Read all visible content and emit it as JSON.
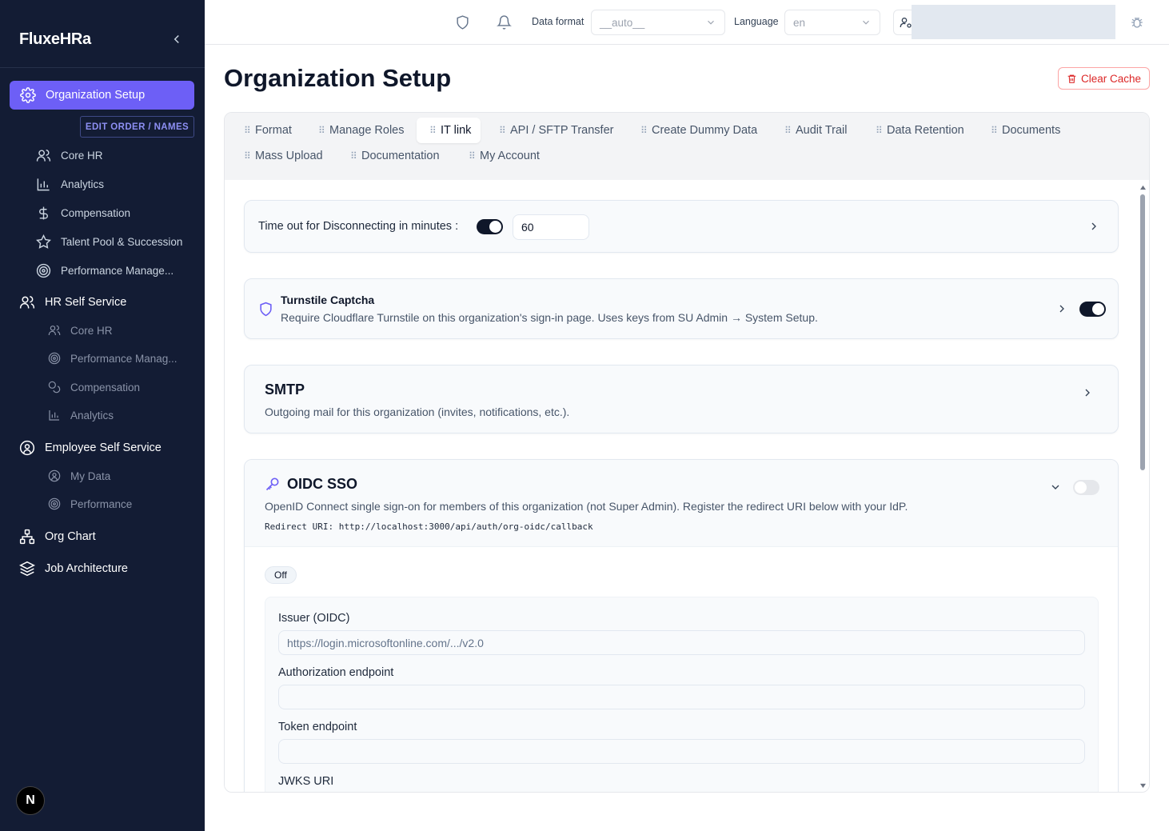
{
  "sidebar": {
    "brand": "FluxeHRa",
    "active_item": "Organization Setup",
    "edit_order_label": "EDIT ORDER / NAMES",
    "group1": [
      {
        "label": "Core HR"
      },
      {
        "label": "Analytics"
      },
      {
        "label": "Compensation"
      },
      {
        "label": "Talent Pool & Succession"
      },
      {
        "label": "Performance Manage..."
      }
    ],
    "hr_self_service": "HR Self Service",
    "group2": [
      {
        "label": "Core HR"
      },
      {
        "label": "Performance Manag..."
      },
      {
        "label": "Compensation"
      },
      {
        "label": "Analytics"
      }
    ],
    "employee_self_service": "Employee Self Service",
    "group3": [
      {
        "label": "My Data"
      },
      {
        "label": "Performance"
      }
    ],
    "org_chart": "Org Chart",
    "job_architecture": "Job Architecture",
    "bottom_logo": "N"
  },
  "topbar": {
    "data_format_label": "Data format",
    "data_format_value": "__auto__",
    "language_label": "Language",
    "language_value": "en"
  },
  "page": {
    "title": "Organization Setup",
    "clear_cache": "Clear Cache"
  },
  "tabs": [
    {
      "label": "Format"
    },
    {
      "label": "Manage Roles"
    },
    {
      "label": "IT link"
    },
    {
      "label": "API / SFTP Transfer"
    },
    {
      "label": "Create Dummy Data"
    },
    {
      "label": "Audit Trail"
    },
    {
      "label": "Data Retention"
    },
    {
      "label": "Documents"
    },
    {
      "label": "Mass Upload"
    },
    {
      "label": "Documentation"
    },
    {
      "label": "My Account"
    }
  ],
  "timeout": {
    "label": "Time out for Disconnecting in minutes :",
    "value": "60",
    "enabled": true
  },
  "turnstile": {
    "title": "Turnstile Captcha",
    "description": "Require Cloudflare Turnstile on this organization's sign-in page. Uses keys from SU Admin → System Setup.",
    "enabled": true
  },
  "smtp": {
    "title": "SMTP",
    "description": "Outgoing mail for this organization (invites, notifications, etc.)."
  },
  "oidc": {
    "title": "OIDC SSO",
    "description": "OpenID Connect single sign-on for members of this organization (not Super Admin). Register the redirect URI below with your IdP.",
    "redirect_uri": "Redirect URI: http://localhost:3000/api/auth/org-oidc/callback",
    "status_badge": "Off",
    "enabled": false,
    "fields": {
      "issuer_label": "Issuer (OIDC)",
      "issuer_placeholder": "https://login.microsoftonline.com/.../v2.0",
      "auth_label": "Authorization endpoint",
      "token_label": "Token endpoint",
      "jwks_label": "JWKS URI"
    }
  },
  "colors": {
    "sidebar_bg": "#131c34",
    "accent": "#6d5ff6",
    "danger": "#dc2626"
  }
}
